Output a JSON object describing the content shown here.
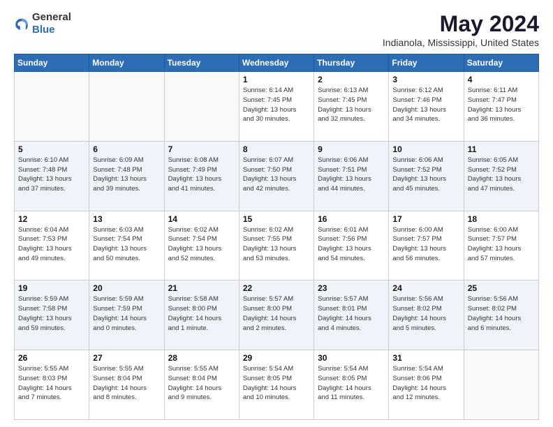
{
  "logo": {
    "general": "General",
    "blue": "Blue"
  },
  "title": "May 2024",
  "location": "Indianola, Mississippi, United States",
  "days_header": [
    "Sunday",
    "Monday",
    "Tuesday",
    "Wednesday",
    "Thursday",
    "Friday",
    "Saturday"
  ],
  "weeks": [
    [
      {
        "day": "",
        "info": ""
      },
      {
        "day": "",
        "info": ""
      },
      {
        "day": "",
        "info": ""
      },
      {
        "day": "1",
        "info": "Sunrise: 6:14 AM\nSunset: 7:45 PM\nDaylight: 13 hours\nand 30 minutes."
      },
      {
        "day": "2",
        "info": "Sunrise: 6:13 AM\nSunset: 7:45 PM\nDaylight: 13 hours\nand 32 minutes."
      },
      {
        "day": "3",
        "info": "Sunrise: 6:12 AM\nSunset: 7:46 PM\nDaylight: 13 hours\nand 34 minutes."
      },
      {
        "day": "4",
        "info": "Sunrise: 6:11 AM\nSunset: 7:47 PM\nDaylight: 13 hours\nand 36 minutes."
      }
    ],
    [
      {
        "day": "5",
        "info": "Sunrise: 6:10 AM\nSunset: 7:48 PM\nDaylight: 13 hours\nand 37 minutes."
      },
      {
        "day": "6",
        "info": "Sunrise: 6:09 AM\nSunset: 7:48 PM\nDaylight: 13 hours\nand 39 minutes."
      },
      {
        "day": "7",
        "info": "Sunrise: 6:08 AM\nSunset: 7:49 PM\nDaylight: 13 hours\nand 41 minutes."
      },
      {
        "day": "8",
        "info": "Sunrise: 6:07 AM\nSunset: 7:50 PM\nDaylight: 13 hours\nand 42 minutes."
      },
      {
        "day": "9",
        "info": "Sunrise: 6:06 AM\nSunset: 7:51 PM\nDaylight: 13 hours\nand 44 minutes."
      },
      {
        "day": "10",
        "info": "Sunrise: 6:06 AM\nSunset: 7:52 PM\nDaylight: 13 hours\nand 45 minutes."
      },
      {
        "day": "11",
        "info": "Sunrise: 6:05 AM\nSunset: 7:52 PM\nDaylight: 13 hours\nand 47 minutes."
      }
    ],
    [
      {
        "day": "12",
        "info": "Sunrise: 6:04 AM\nSunset: 7:53 PM\nDaylight: 13 hours\nand 49 minutes."
      },
      {
        "day": "13",
        "info": "Sunrise: 6:03 AM\nSunset: 7:54 PM\nDaylight: 13 hours\nand 50 minutes."
      },
      {
        "day": "14",
        "info": "Sunrise: 6:02 AM\nSunset: 7:54 PM\nDaylight: 13 hours\nand 52 minutes."
      },
      {
        "day": "15",
        "info": "Sunrise: 6:02 AM\nSunset: 7:55 PM\nDaylight: 13 hours\nand 53 minutes."
      },
      {
        "day": "16",
        "info": "Sunrise: 6:01 AM\nSunset: 7:56 PM\nDaylight: 13 hours\nand 54 minutes."
      },
      {
        "day": "17",
        "info": "Sunrise: 6:00 AM\nSunset: 7:57 PM\nDaylight: 13 hours\nand 56 minutes."
      },
      {
        "day": "18",
        "info": "Sunrise: 6:00 AM\nSunset: 7:57 PM\nDaylight: 13 hours\nand 57 minutes."
      }
    ],
    [
      {
        "day": "19",
        "info": "Sunrise: 5:59 AM\nSunset: 7:58 PM\nDaylight: 13 hours\nand 59 minutes."
      },
      {
        "day": "20",
        "info": "Sunrise: 5:59 AM\nSunset: 7:59 PM\nDaylight: 14 hours\nand 0 minutes."
      },
      {
        "day": "21",
        "info": "Sunrise: 5:58 AM\nSunset: 8:00 PM\nDaylight: 14 hours\nand 1 minute."
      },
      {
        "day": "22",
        "info": "Sunrise: 5:57 AM\nSunset: 8:00 PM\nDaylight: 14 hours\nand 2 minutes."
      },
      {
        "day": "23",
        "info": "Sunrise: 5:57 AM\nSunset: 8:01 PM\nDaylight: 14 hours\nand 4 minutes."
      },
      {
        "day": "24",
        "info": "Sunrise: 5:56 AM\nSunset: 8:02 PM\nDaylight: 14 hours\nand 5 minutes."
      },
      {
        "day": "25",
        "info": "Sunrise: 5:56 AM\nSunset: 8:02 PM\nDaylight: 14 hours\nand 6 minutes."
      }
    ],
    [
      {
        "day": "26",
        "info": "Sunrise: 5:55 AM\nSunset: 8:03 PM\nDaylight: 14 hours\nand 7 minutes."
      },
      {
        "day": "27",
        "info": "Sunrise: 5:55 AM\nSunset: 8:04 PM\nDaylight: 14 hours\nand 8 minutes."
      },
      {
        "day": "28",
        "info": "Sunrise: 5:55 AM\nSunset: 8:04 PM\nDaylight: 14 hours\nand 9 minutes."
      },
      {
        "day": "29",
        "info": "Sunrise: 5:54 AM\nSunset: 8:05 PM\nDaylight: 14 hours\nand 10 minutes."
      },
      {
        "day": "30",
        "info": "Sunrise: 5:54 AM\nSunset: 8:05 PM\nDaylight: 14 hours\nand 11 minutes."
      },
      {
        "day": "31",
        "info": "Sunrise: 5:54 AM\nSunset: 8:06 PM\nDaylight: 14 hours\nand 12 minutes."
      },
      {
        "day": "",
        "info": ""
      }
    ]
  ]
}
